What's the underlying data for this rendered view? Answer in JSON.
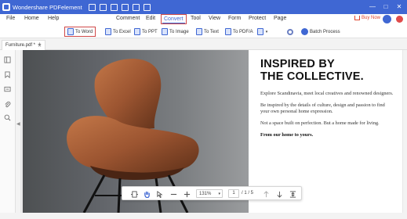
{
  "titlebar": {
    "app_title": "Wondershare PDFelement",
    "window_controls": [
      "—",
      "□",
      "✕"
    ]
  },
  "menubar": {
    "items": [
      "File",
      "Home",
      "Help",
      "Comment",
      "Edit",
      "Convert",
      "Tool",
      "View",
      "Form",
      "Protect",
      "Page"
    ],
    "active": "Convert",
    "buy_now": "Buy Now"
  },
  "toolbar": {
    "tools": [
      "To Word",
      "To Excel",
      "To PPT",
      "To Image",
      "To Text",
      "To PDF/A"
    ],
    "batch_process": "Batch Process"
  },
  "document": {
    "tab_name": "Furniture.pdf *",
    "add_tab": "+",
    "headline_line1": "INSPIRED BY",
    "headline_line2": "THE COLLECTIVE.",
    "para1": "Explore Scandinavia, meet local creatives and renowned designers.",
    "para2": "Be inspired by the details of culture, design and passion to find your own personal home expression.",
    "para3": "Not a space built on perfection. But a home made for living.",
    "para4": "From our home to yours."
  },
  "zoombar": {
    "zoom": "131%",
    "current_page": "1",
    "page_count": "/ 1 / 5"
  },
  "colors": {
    "brand_blue": "#3f67d3",
    "highlight_red": "#d04848",
    "buy_now": "#e0462f"
  },
  "icons": {
    "sidebar": [
      "thumbnail-icon",
      "bookmark-icon",
      "comment-icon",
      "attachment-icon",
      "search-icon"
    ]
  }
}
